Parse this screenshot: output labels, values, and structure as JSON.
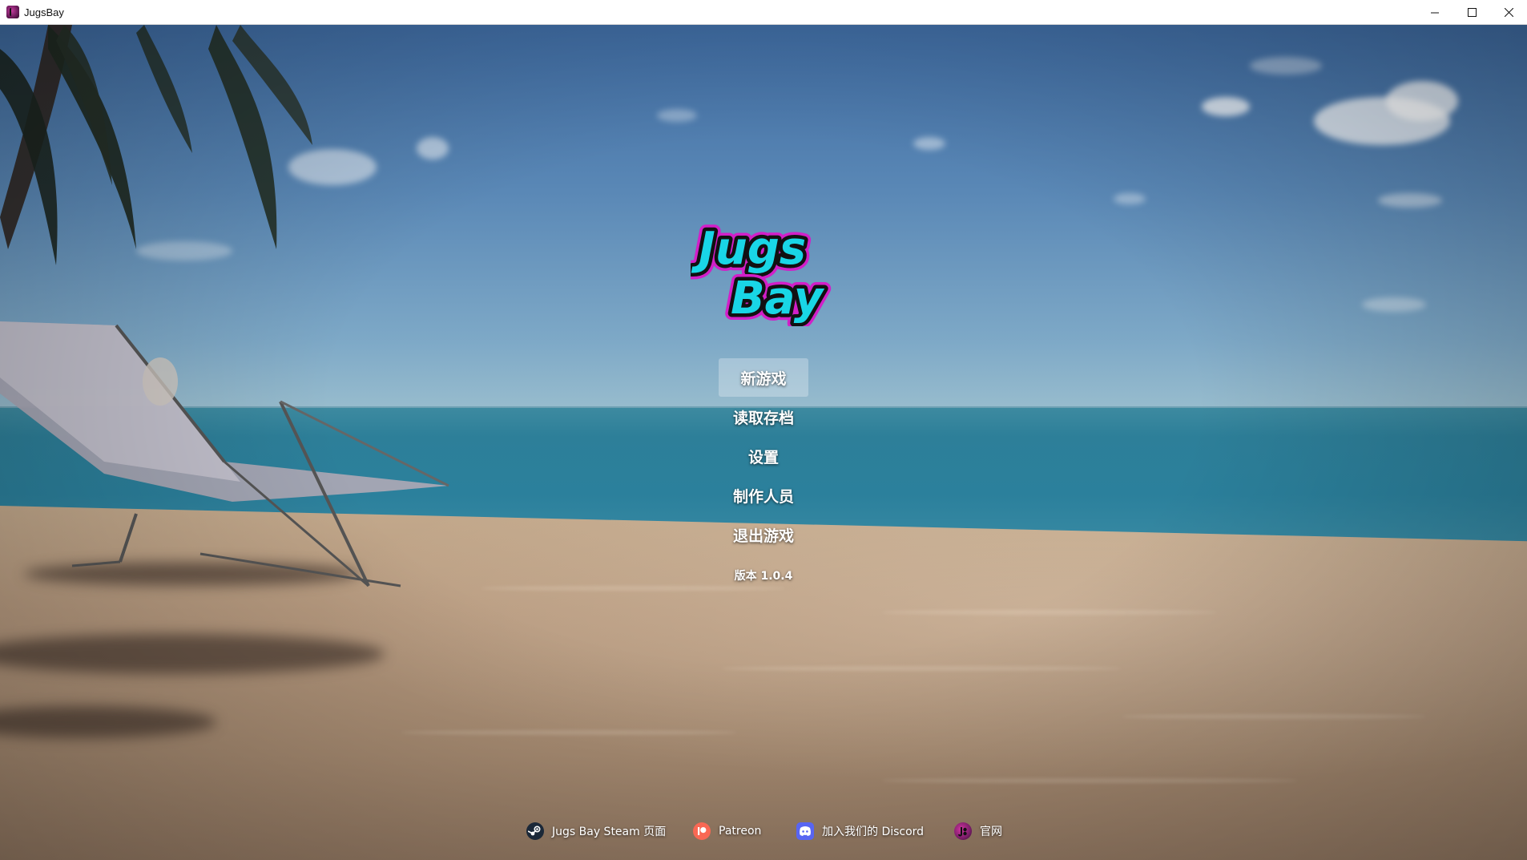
{
  "window": {
    "title": "JugsBay",
    "controls": {
      "minimize_icon": "minimize-icon",
      "maximize_icon": "maximize-icon",
      "close_icon": "close-icon"
    }
  },
  "logo": {
    "line1": "Jugs",
    "line2": "Bay",
    "fill_color": "#19d6e6",
    "outline_color": "#d21fc8"
  },
  "menu": {
    "items": [
      {
        "label": "新游戏",
        "active": true
      },
      {
        "label": "读取存档",
        "active": false
      },
      {
        "label": "设置",
        "active": false
      },
      {
        "label": "制作人员",
        "active": false
      },
      {
        "label": "退出游戏",
        "active": false
      }
    ],
    "version": "版本 1.0.4"
  },
  "footer": {
    "links": [
      {
        "label": "Jugs Bay Steam 页面",
        "icon": "steam-icon"
      },
      {
        "label": "Patreon",
        "icon": "patreon-icon"
      },
      {
        "label": "加入我们的 Discord",
        "icon": "discord-icon"
      },
      {
        "label": "官网",
        "icon": "website-icon"
      }
    ]
  },
  "colors": {
    "menu_text": "#ffffff",
    "active_highlight": "rgba(255,255,255,0.28)",
    "patreon": "#f96854",
    "discord": "#5865f2",
    "steam": "#1b2838"
  }
}
